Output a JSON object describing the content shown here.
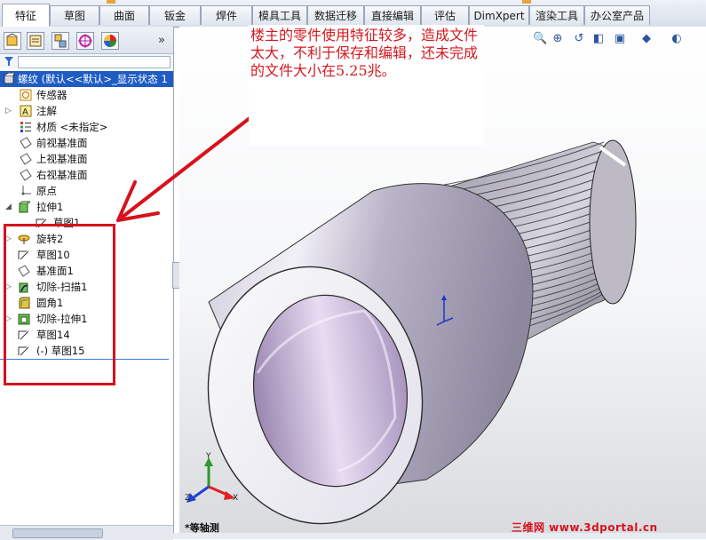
{
  "command_tabs": [
    {
      "label": "特征",
      "active": true
    },
    {
      "label": "草图"
    },
    {
      "label": "曲面"
    },
    {
      "label": "钣金"
    },
    {
      "label": "焊件"
    },
    {
      "label": "模具工具"
    },
    {
      "label": "数据迁移"
    },
    {
      "label": "直接编辑"
    },
    {
      "label": "评估"
    },
    {
      "label": "DimXpert"
    },
    {
      "label": "渲染工具"
    },
    {
      "label": "办公室产品"
    }
  ],
  "feature_manager": {
    "panel_tabs": [
      "feature-manager-icon",
      "property-manager-icon",
      "configuration-manager-icon",
      "dimxpert-manager-icon",
      "display-manager-icon"
    ],
    "expand_glyph": "»",
    "filter_icon": "filter-icon",
    "root_label": "螺纹 (默认<<默认>_显示状态 1",
    "tree": [
      {
        "label": "传感器",
        "icon": "sensor-icon"
      },
      {
        "label": "注解",
        "icon": "annotation-icon"
      },
      {
        "label": "材质 <未指定>",
        "icon": "material-icon"
      },
      {
        "label": "前视基准面",
        "icon": "plane-icon"
      },
      {
        "label": "上视基准面",
        "icon": "plane-icon"
      },
      {
        "label": "右视基准面",
        "icon": "plane-icon"
      },
      {
        "label": "原点",
        "icon": "origin-icon"
      },
      {
        "label": "拉伸1",
        "icon": "extrude-icon"
      },
      {
        "label": "草图1",
        "icon": "sketch-icon"
      },
      {
        "label": "旋转2",
        "icon": "revolve-icon"
      },
      {
        "label": "草图10",
        "icon": "sketch-icon"
      },
      {
        "label": "基准面1",
        "icon": "plane-icon"
      },
      {
        "label": "切除-扫描1",
        "icon": "cut-sweep-icon"
      },
      {
        "label": "圆角1",
        "icon": "fillet-icon"
      },
      {
        "label": "切除-拉伸1",
        "icon": "cut-extrude-icon"
      },
      {
        "label": "草图14",
        "icon": "sketch-icon"
      },
      {
        "label": "(-) 草图15",
        "icon": "sketch-icon"
      }
    ]
  },
  "viewport": {
    "toolbar_icons": [
      "zoom-to-fit-icon",
      "zoom-area-icon",
      "previous-view-icon",
      "section-view-icon",
      "view-orientation-icon",
      "display-style-icon",
      "hide-show-icon"
    ],
    "callout_text": "楼主的零件使用特征较多，造成文件太大，不利于保存和编辑，还未完成的文件大小在5.25兆。",
    "view_name": "*等轴测",
    "watermark": "三维网 www.3dportal.cn",
    "triad": {
      "x": "X",
      "y": "Y",
      "z": "Z"
    }
  },
  "colors": {
    "annotation_red": "#d6121d",
    "selection_blue": "#1e5cc4",
    "part_metal": "#b9b3c8"
  }
}
